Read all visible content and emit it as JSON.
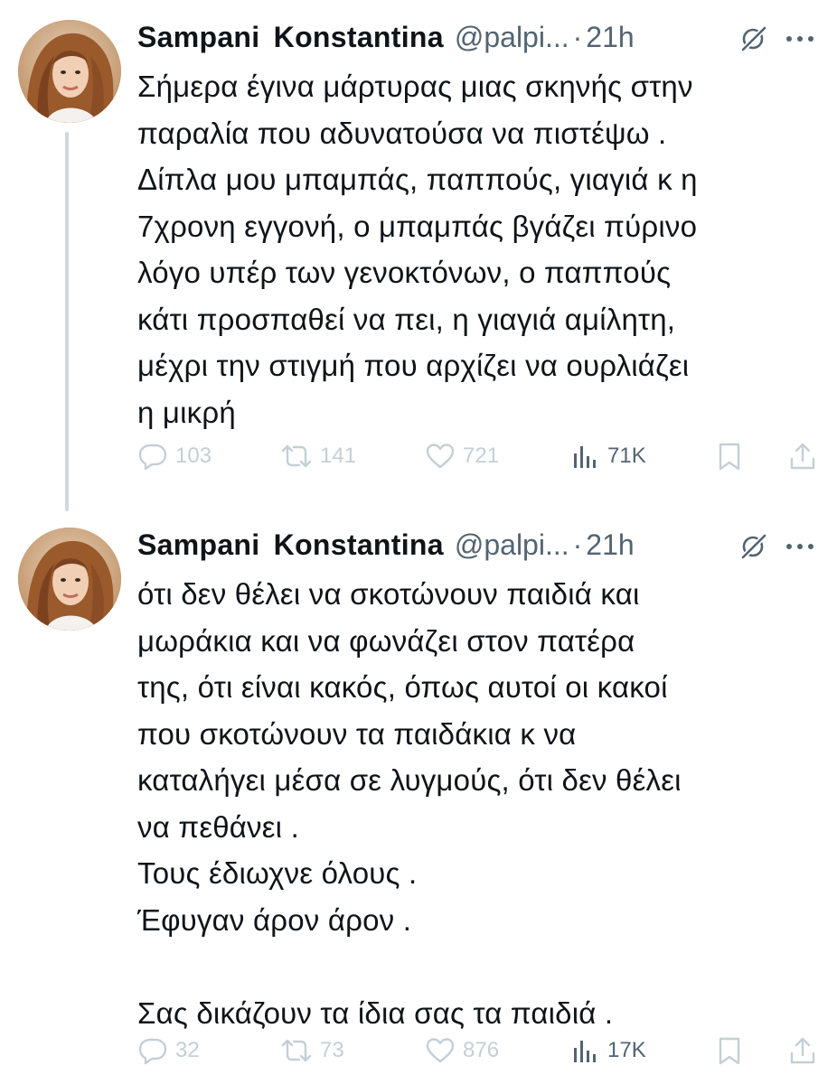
{
  "colors": {
    "text_primary": "#0f1419",
    "text_secondary": "#536471",
    "icon_faint": "#c4cfd6",
    "thread_line": "#cfd9de"
  },
  "tweets": [
    {
      "author": {
        "name": "Sampani  Konstantina",
        "handle": "@palpi...",
        "separator": "·",
        "time": "21h"
      },
      "lines": [
        "Σήμερα έγινα μάρτυρας μιας σκηνής στην",
        "παραλία που αδυνατούσα να πιστέψω .",
        "Δίπλα μου μπαμπάς, παππούς, γιαγιά κ η",
        "7χρονη εγγονή, ο μπαμπάς βγάζει πύρινο",
        "λόγο υπέρ των γενοκτόνων, ο παππούς",
        "κάτι προσπαθεί να πει, η γιαγιά αμίλητη,",
        "μέχρι την στιγμή που αρχίζει να ουρλιάζει",
        "η μικρή"
      ],
      "stats": {
        "replies": "103",
        "retweets": "141",
        "likes": "721",
        "views": "71K"
      },
      "icons": {
        "reply": "reply-icon",
        "retweet": "retweet-icon",
        "like": "heart-icon",
        "views": "views-chart-icon",
        "bookmark": "bookmark-icon",
        "share": "share-icon",
        "grok": "grok-icon",
        "more": "more-icon"
      }
    },
    {
      "author": {
        "name": "Sampani  Konstantina",
        "handle": "@palpi...",
        "separator": "·",
        "time": "21h"
      },
      "lines": [
        "ότι δεν θέλει να σκοτώνουν παιδιά και",
        "μωράκια και να φωνάζει στον πατέρα",
        "της, ότι είναι κακός, όπως αυτοί οι κακοί",
        "που σκοτώνουν τα παιδάκια κ να",
        "καταλήγει μέσα σε λυγμούς, ότι δεν θέλει",
        "να πεθάνει .",
        "Τους έδιωχνε όλους .",
        "Έφυγαν άρον άρον .",
        "",
        "Σας δικάζουν τα ίδια σας τα παιδιά ."
      ],
      "stats": {
        "replies": "32",
        "retweets": "73",
        "likes": "876",
        "views": "17K"
      },
      "icons": {
        "reply": "reply-icon",
        "retweet": "retweet-icon",
        "like": "heart-icon",
        "views": "views-chart-icon",
        "bookmark": "bookmark-icon",
        "share": "share-icon",
        "grok": "grok-icon",
        "more": "more-icon"
      }
    }
  ]
}
